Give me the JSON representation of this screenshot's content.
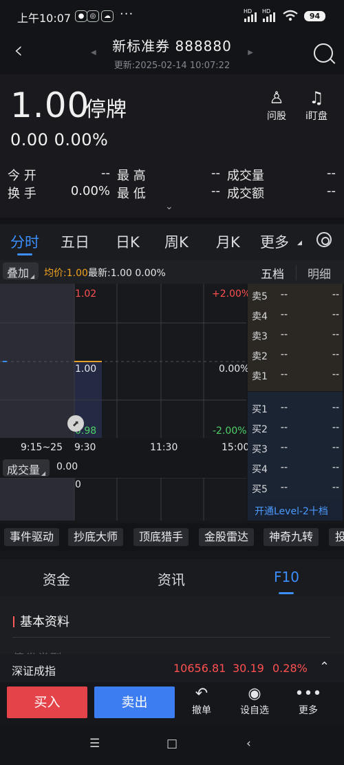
{
  "status_bar": {
    "time": "上午10:07",
    "battery": "94",
    "signal_1_label": "HD",
    "signal_2_label": "HD"
  },
  "header": {
    "title": "新标准券 888880",
    "updated_at": "更新:2025-02-14 10:07:22"
  },
  "quote": {
    "price": "1.00",
    "status": "停牌",
    "change": "0.00",
    "change_pct": "0.00%",
    "ask_stock_label": "问股",
    "watch_label": "i盯盘",
    "metrics": [
      {
        "label": "今 开",
        "value": "--"
      },
      {
        "label": "最 高",
        "value": "--"
      },
      {
        "label": "成交量",
        "value": "--"
      },
      {
        "label": "换 手",
        "value": "0.00%"
      },
      {
        "label": "最 低",
        "value": "--"
      },
      {
        "label": "成交额",
        "value": "--"
      }
    ]
  },
  "chart_tabs": [
    "分时",
    "五日",
    "日K",
    "周K",
    "月K",
    "更多"
  ],
  "overlay": {
    "label": "叠加",
    "avg_price": "均价:1.00",
    "latest": "最新:1.00 0.00%",
    "five_levels": "五档",
    "details": "明细"
  },
  "intraday": {
    "top_price": "1.02",
    "top_pct": "+2.00%",
    "mid_price": "1.00",
    "mid_pct": "0.00%",
    "bottom_price": "0.98",
    "bottom_pct": "-2.00%",
    "x_labels": [
      "9:15~25",
      "9:30",
      "11:30",
      "15:00"
    ],
    "volume_label": "成交量",
    "volume_value": "0.00",
    "volume_axis": "0"
  },
  "orderbook": {
    "sell_levels": [
      {
        "label": "卖5",
        "price": "--",
        "qty": "--"
      },
      {
        "label": "卖4",
        "price": "--",
        "qty": "--"
      },
      {
        "label": "卖3",
        "price": "--",
        "qty": "--"
      },
      {
        "label": "卖2",
        "price": "--",
        "qty": "--"
      },
      {
        "label": "卖1",
        "price": "--",
        "qty": "--"
      }
    ],
    "buy_levels": [
      {
        "label": "买1",
        "price": "--",
        "qty": "--"
      },
      {
        "label": "买2",
        "price": "--",
        "qty": "--"
      },
      {
        "label": "买3",
        "price": "--",
        "qty": "--"
      },
      {
        "label": "买4",
        "price": "--",
        "qty": "--"
      },
      {
        "label": "买5",
        "price": "--",
        "qty": "--"
      }
    ],
    "level2_label": "开通Level-2十档"
  },
  "features": [
    "事件驱动",
    "抄底大师",
    "顶底猎手",
    "金股雷达",
    "神奇九转",
    "投"
  ],
  "sections": [
    "资金",
    "资讯",
    "F10"
  ],
  "content": {
    "section_title": "基本资料",
    "faded_text": "债券类型"
  },
  "index_bar": {
    "name": "深证成指",
    "value": "10656.81",
    "change": "30.19",
    "pct": "0.28%"
  },
  "bottom_actions": {
    "buy": "买入",
    "sell": "卖出",
    "cancel": "撤单",
    "watchlist": "设自选",
    "more": "更多"
  }
}
